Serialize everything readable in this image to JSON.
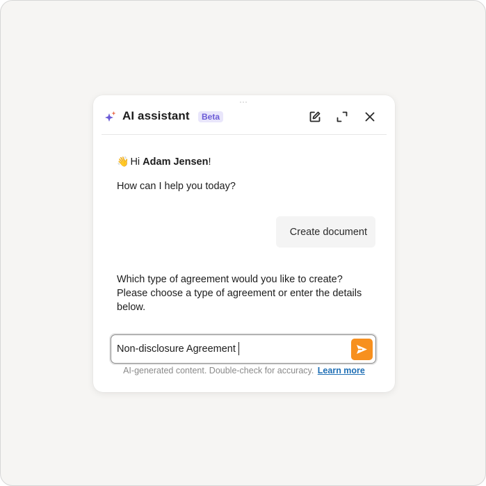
{
  "assistant": {
    "title": "AI assistant",
    "badge": "Beta",
    "accent_color": "#6b5bd6",
    "icons": {
      "sparkle": "sparkle-icon",
      "new_chat": "edit-icon",
      "expand": "expand-icon",
      "close": "close-icon"
    }
  },
  "conversation": {
    "greeting_prefix": "Hi ",
    "user_name": "Adam Jensen",
    "greeting_suffix": "!",
    "help_text": "How can I help you today?",
    "user_message": "Create document",
    "assistant_reply": "Which type of agreement would you like to create? Please choose a type of agreement or enter the details below."
  },
  "composer": {
    "value": "Non-disclosure Agreement",
    "send_color": "#f7901e"
  },
  "footer": {
    "disclaimer": "AI-generated content. Double-check for accuracy.",
    "link_label": "Learn more"
  }
}
